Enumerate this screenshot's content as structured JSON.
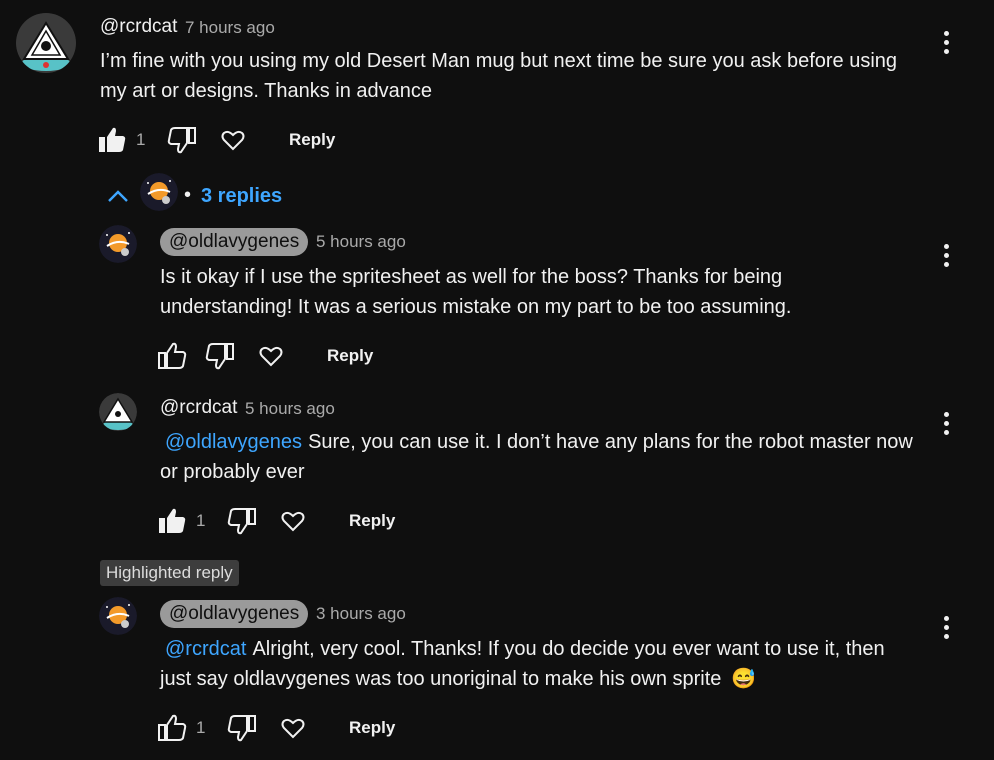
{
  "comment": {
    "author": "@rcrdcat",
    "time": "7 hours ago",
    "text": "I’m fine with you using my old Desert Man mug but next time be sure you ask before using my art or designs. Thanks in advance",
    "likes": "1",
    "reply_label": "Reply"
  },
  "replies_toggle": {
    "separator": "•",
    "label": "3 replies"
  },
  "replies": [
    {
      "author": "@oldlavygenes",
      "time": "5 hours ago",
      "text": "Is it okay if I use the spritesheet as well for the boss? Thanks for being understanding! It was a serious mistake on my part to be too assuming.",
      "reply_label": "Reply"
    },
    {
      "author": "@rcrdcat",
      "time": "5 hours ago",
      "mention": "@oldlavygenes",
      "text": "Sure, you can use it. I don’t have any plans for the robot master now or probably ever",
      "likes": "1",
      "reply_label": "Reply"
    },
    {
      "badge": "Highlighted reply",
      "author": "@oldlavygenes",
      "time": "3 hours ago",
      "mention": "@rcrdcat",
      "text": "Alright, very cool. Thanks! If you do decide you ever want to use it, then just say oldlavygenes was too unoriginal to make his own sprite",
      "emoji": "😅",
      "likes": "1",
      "reply_label": "Reply"
    }
  ],
  "colors": {
    "background": "#0f0f0f",
    "text": "#f1f1f1",
    "muted": "#aaaaaa",
    "link": "#3ea6ff"
  }
}
